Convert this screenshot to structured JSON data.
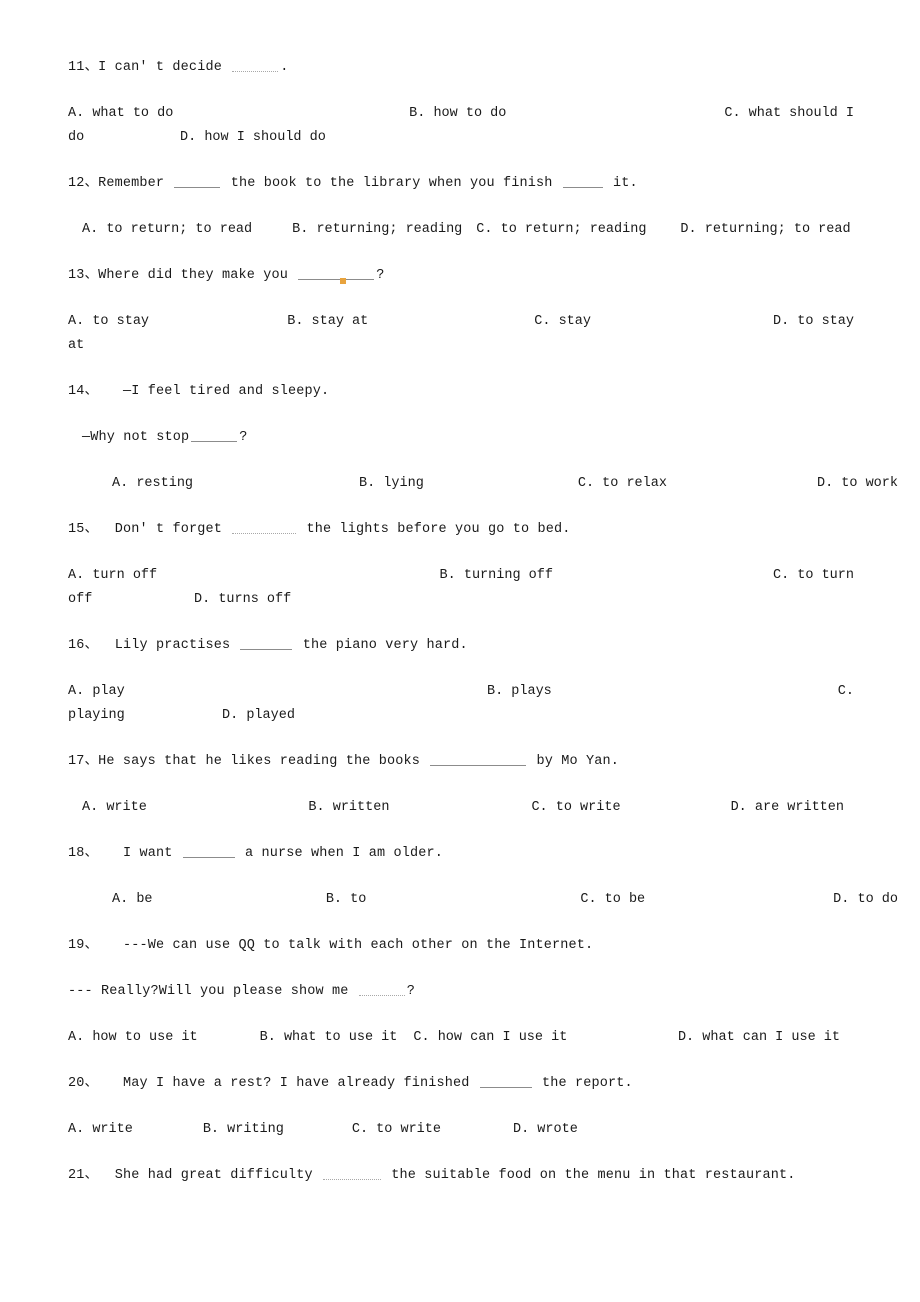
{
  "document": {
    "type": "exam-worksheet",
    "subject": "English grammar multiple choice",
    "language": "en",
    "page_background": "#ffffff",
    "text_color": "#1a1a1a",
    "blank_color": "#9a9a9a",
    "mark_color": "#e8a33d"
  },
  "questions": [
    {
      "number": "11",
      "sep": "、",
      "stem_pre": "I can' t decide ",
      "stem_post": ".",
      "options": [
        {
          "label": "A.",
          "text": "what to do"
        },
        {
          "label": "B.",
          "text": "how to do"
        },
        {
          "label": "C.",
          "text": "what should I"
        },
        {
          "label": "",
          "text": "do"
        },
        {
          "label": "D.",
          "text": "how I should do"
        }
      ]
    },
    {
      "number": "12",
      "sep": "、",
      "stem_pre": "Remember ",
      "stem_mid": " the book to the library when you finish ",
      "stem_post": " it.",
      "options": [
        {
          "label": "A.",
          "text": "to return; to read"
        },
        {
          "label": "B.",
          "text": "returning; reading"
        },
        {
          "label": "C.",
          "text": "to return; reading"
        },
        {
          "label": "D.",
          "text": "returning; to read"
        }
      ]
    },
    {
      "number": "13",
      "sep": "、",
      "stem_pre": "Where did they make you ",
      "stem_post": "?",
      "options": [
        {
          "label": "A.",
          "text": "to stay"
        },
        {
          "label": "B.",
          "text": "stay at"
        },
        {
          "label": "C.",
          "text": "stay"
        },
        {
          "label": "D.",
          "text": "to stay"
        },
        {
          "label": "",
          "text": "at"
        }
      ]
    },
    {
      "number": "14",
      "sep": "、",
      "stem_pre": "—I feel tired and sleepy.",
      "stem_line2_pre": "—Why not stop",
      "stem_line2_post": "?",
      "options": [
        {
          "label": "A.",
          "text": "resting"
        },
        {
          "label": "B.",
          "text": "lying"
        },
        {
          "label": "C.",
          "text": "to relax"
        },
        {
          "label": "D.",
          "text": "to work"
        }
      ]
    },
    {
      "number": "15",
      "sep": "、",
      "stem_pre": "Don' t forget ",
      "stem_post": " the lights before you go to bed.",
      "options": [
        {
          "label": "A.",
          "text": "turn off"
        },
        {
          "label": "B.",
          "text": "turning off"
        },
        {
          "label": "C.",
          "text": "to turn"
        },
        {
          "label": "",
          "text": "off"
        },
        {
          "label": "D.",
          "text": "turns off"
        }
      ]
    },
    {
      "number": "16",
      "sep": "、",
      "stem_pre": "Lily practises ",
      "stem_post": " the piano very hard.",
      "options": [
        {
          "label": "A.",
          "text": "play"
        },
        {
          "label": "B.",
          "text": "plays"
        },
        {
          "label": "C.",
          "text": ""
        },
        {
          "label": "",
          "text": "playing"
        },
        {
          "label": "D.",
          "text": "played"
        }
      ]
    },
    {
      "number": "17",
      "sep": "、",
      "stem_pre": "He says that he likes reading the books ",
      "stem_post": " by Mo Yan.",
      "options": [
        {
          "label": "A.",
          "text": "write"
        },
        {
          "label": "B.",
          "text": "written"
        },
        {
          "label": "C.",
          "text": "to write"
        },
        {
          "label": "D.",
          "text": "are written"
        }
      ]
    },
    {
      "number": "18",
      "sep": "、",
      "stem_pre": "I want ",
      "stem_post": " a nurse when I am older.",
      "options": [
        {
          "label": "A.",
          "text": "be"
        },
        {
          "label": "B.",
          "text": "to"
        },
        {
          "label": "C.",
          "text": "to be"
        },
        {
          "label": "D.",
          "text": "to do"
        }
      ]
    },
    {
      "number": "19",
      "sep": "、",
      "stem_pre": "---We can use QQ to talk with each other on the Internet.",
      "stem_line2_pre": "--- Really?Will you please show me ",
      "stem_line2_post": "?",
      "options": [
        {
          "label": "A.",
          "text": "how to use it"
        },
        {
          "label": "B.",
          "text": "what to use it"
        },
        {
          "label": "C.",
          "text": "how can I use it"
        },
        {
          "label": "D.",
          "text": "what can I use it"
        }
      ]
    },
    {
      "number": "20",
      "sep": "、",
      "stem_pre": "May I have a rest? I have already finished ",
      "stem_post": " the report.",
      "options": [
        {
          "label": "A.",
          "text": "write"
        },
        {
          "label": "B.",
          "text": "writing"
        },
        {
          "label": "C.",
          "text": "to write"
        },
        {
          "label": "D.",
          "text": "wrote"
        }
      ]
    },
    {
      "number": "21",
      "sep": "、",
      "stem_pre": "She had great difficulty ",
      "stem_post": " the suitable food on the menu in that restaurant.",
      "options": []
    }
  ]
}
